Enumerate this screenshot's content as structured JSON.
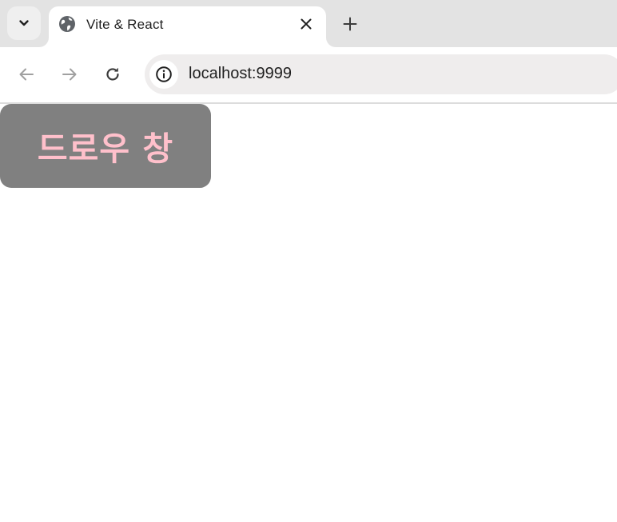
{
  "browser": {
    "tab": {
      "title": "Vite & React"
    },
    "omnibox": {
      "url": "localhost:9999"
    }
  },
  "page": {
    "drawer_title": "드로우 창"
  },
  "colors": {
    "tabstrip_bg": "#e3e3e3",
    "omnibox_bg": "#efeded",
    "drawer_bg": "#808080",
    "drawer_text": "#ffc0cb"
  },
  "icons": {
    "tab_search": "chevron-down-icon",
    "favicon": "globe-icon",
    "tab_close": "close-icon",
    "new_tab": "plus-icon",
    "back": "arrow-left-icon",
    "forward": "arrow-right-icon",
    "reload": "reload-icon",
    "site_info": "info-icon"
  }
}
